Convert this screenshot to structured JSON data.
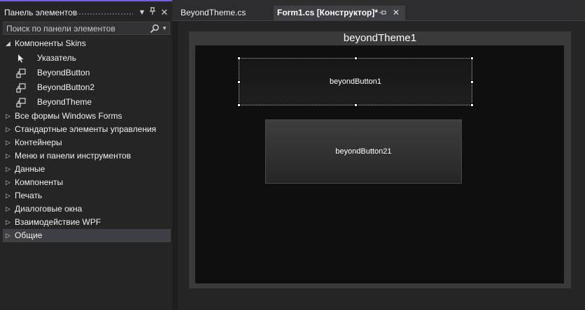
{
  "toolbox": {
    "title": "Панель элементов",
    "search": {
      "placeholder": "Поиск по панели элементов",
      "value": ""
    },
    "group_expanded": {
      "label": "Компоненты Skins",
      "items": [
        {
          "label": "Указатель",
          "icon": "pointer-icon"
        },
        {
          "label": "BeyondButton",
          "icon": "component-icon"
        },
        {
          "label": "BeyondButton2",
          "icon": "component-icon"
        },
        {
          "label": "BeyondTheme",
          "icon": "component-icon"
        }
      ]
    },
    "groups": [
      {
        "label": "Все формы Windows Forms"
      },
      {
        "label": "Стандартные элементы управления"
      },
      {
        "label": "Контейнеры"
      },
      {
        "label": "Меню и панели инструментов"
      },
      {
        "label": "Данные"
      },
      {
        "label": "Компоненты"
      },
      {
        "label": "Печать"
      },
      {
        "label": "Диалоговые окна"
      },
      {
        "label": "Взаимодействие WPF"
      },
      {
        "label": "Общие",
        "selected": true
      }
    ]
  },
  "tabs": [
    {
      "label": "BeyondTheme.cs",
      "active": false
    },
    {
      "label": "Form1.cs [Конструктор]*",
      "active": true
    }
  ],
  "designer": {
    "form_title": "beyondTheme1",
    "button1_label": "beyondButton1",
    "button2_label": "beyondButton21"
  },
  "colors": {
    "accent": "#7160e8",
    "panel_bg": "#252526",
    "selected_row": "#3f3f46",
    "form_frame": "#3a3a3a",
    "form_body": "#0f0f0f"
  }
}
